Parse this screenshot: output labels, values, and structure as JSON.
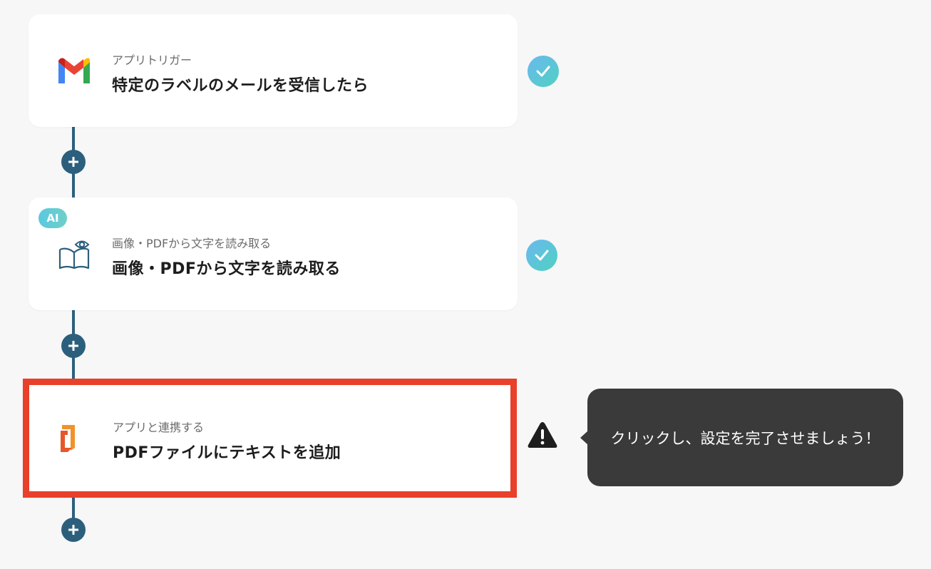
{
  "flow": {
    "steps": [
      {
        "subtitle": "アプリトリガー",
        "title": "特定のラベルのメールを受信したら",
        "icon": "gmail-icon",
        "status": "complete"
      },
      {
        "badge": "AI",
        "subtitle": "画像・PDFから文字を読み取る",
        "title": "画像・PDFから文字を読み取る",
        "icon": "book-eye-icon",
        "status": "complete"
      },
      {
        "subtitle": "アプリと連携する",
        "title": "PDFファイルにテキストを追加",
        "icon": "pdf-app-icon",
        "status": "warning"
      }
    ]
  },
  "tooltip": {
    "text": "クリックし、設定を完了させましょう！"
  },
  "colors": {
    "connector": "#2c5f7c",
    "highlight": "#e8402a",
    "check_gradient_start": "#6bb8f0",
    "check_gradient_end": "#4fd1c0",
    "tooltip_bg": "#3a3a3a"
  }
}
